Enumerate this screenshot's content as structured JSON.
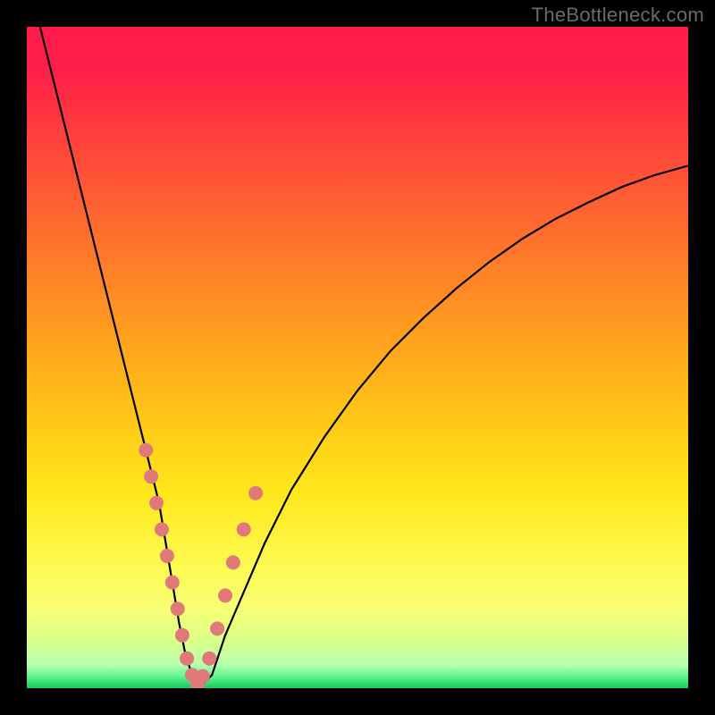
{
  "watermark": "TheBottleneck.com",
  "colors": {
    "frame_bg": "#000000",
    "gradient_stops": [
      {
        "offset": 0.0,
        "c": "#ff1a4a"
      },
      {
        "offset": 0.06,
        "c": "#ff1e49"
      },
      {
        "offset": 0.15,
        "c": "#ff3b3e"
      },
      {
        "offset": 0.3,
        "c": "#ff6a2f"
      },
      {
        "offset": 0.45,
        "c": "#ff9a20"
      },
      {
        "offset": 0.58,
        "c": "#ffc317"
      },
      {
        "offset": 0.7,
        "c": "#ffe61a"
      },
      {
        "offset": 0.8,
        "c": "#fff84a"
      },
      {
        "offset": 0.88,
        "c": "#f7ff74"
      },
      {
        "offset": 0.93,
        "c": "#d9ff8a"
      },
      {
        "offset": 0.965,
        "c": "#b7ffb0"
      },
      {
        "offset": 0.985,
        "c": "#53f08a"
      },
      {
        "offset": 1.0,
        "c": "#18c75a"
      }
    ],
    "curve": "#000000",
    "dot_fill": "#e07a7a",
    "dot_stroke": "#a94f4f"
  },
  "chart_data": {
    "type": "line",
    "title": "",
    "xlabel": "",
    "ylabel": "",
    "xlim": [
      0,
      100
    ],
    "ylim": [
      0,
      100
    ],
    "series": [
      {
        "name": "bottleneck-curve",
        "x": [
          2,
          4,
          6,
          8,
          10,
          12,
          14,
          16,
          18,
          20,
          21,
          22,
          23,
          24,
          25,
          26,
          28,
          30,
          33,
          36,
          40,
          45,
          50,
          55,
          60,
          65,
          70,
          75,
          80,
          85,
          90,
          95,
          100
        ],
        "y": [
          100,
          92,
          84,
          76,
          68,
          60,
          52,
          44,
          36,
          28,
          22,
          16,
          10,
          5,
          2,
          0,
          2,
          8,
          15,
          22,
          30,
          38,
          45,
          51,
          56,
          60.5,
          64.5,
          68,
          71,
          73.5,
          75.8,
          77.6,
          79
        ]
      }
    ],
    "dots": {
      "name": "marked-points",
      "x": [
        18.0,
        18.8,
        19.6,
        20.4,
        21.2,
        22.0,
        22.8,
        23.5,
        24.2,
        25.0,
        25.8,
        26.6,
        27.6,
        28.8,
        30.0,
        31.2,
        32.8,
        34.6
      ],
      "y": [
        36.0,
        32.0,
        28.0,
        24.0,
        20.0,
        16.0,
        12.0,
        8.0,
        4.5,
        2.0,
        0.5,
        1.8,
        4.5,
        9.0,
        14.0,
        19.0,
        24.0,
        29.5
      ]
    }
  }
}
